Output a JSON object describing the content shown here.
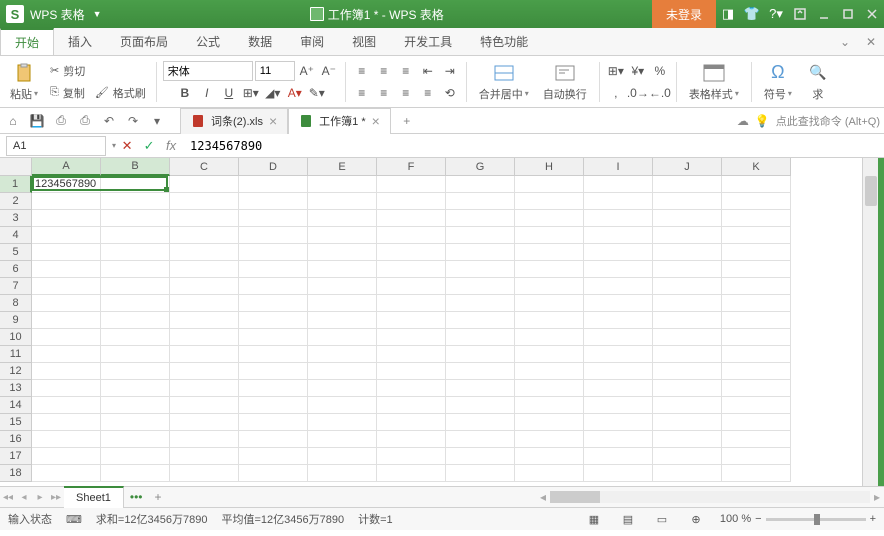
{
  "titlebar": {
    "logo_letter": "S",
    "app_name": "WPS 表格",
    "doc_title": "工作簿1 * - WPS 表格",
    "login": "未登录"
  },
  "menu": {
    "tabs": [
      "开始",
      "插入",
      "页面布局",
      "公式",
      "数据",
      "审阅",
      "视图",
      "开发工具",
      "特色功能"
    ],
    "active_index": 0
  },
  "ribbon": {
    "paste": "粘贴",
    "cut": "剪切",
    "copy": "复制",
    "format_painter": "格式刷",
    "font_name": "宋体",
    "font_size": "11",
    "merge_center": "合并居中",
    "wrap_text": "自动换行",
    "table_style": "表格样式",
    "symbol": "符号",
    "find": "求"
  },
  "qat": {
    "tabs": [
      {
        "label": "词条(2).xls",
        "active": false,
        "icon_color": "#c0392b"
      },
      {
        "label": "工作簿1 *",
        "active": true,
        "icon_color": "#3d8c3d"
      }
    ],
    "search_hint": "点此查找命令 (Alt+Q)"
  },
  "formula_bar": {
    "cell_ref": "A1",
    "formula": "1234567890"
  },
  "grid": {
    "columns": [
      "A",
      "B",
      "C",
      "D",
      "E",
      "F",
      "G",
      "H",
      "I",
      "J",
      "K"
    ],
    "row_count": 18,
    "selected_cols": [
      "A",
      "B"
    ],
    "selected_row": 1,
    "cells": {
      "A1": "1234567890"
    },
    "selection": {
      "from": "A1",
      "to": "B1"
    }
  },
  "sheets": {
    "active": "Sheet1",
    "list": [
      "Sheet1"
    ]
  },
  "statusbar": {
    "mode": "输入状态",
    "sum_label": "求和=12亿3456万7890",
    "avg_label": "平均值=12亿3456万7890",
    "count_label": "计数=1",
    "zoom": "100 %"
  }
}
